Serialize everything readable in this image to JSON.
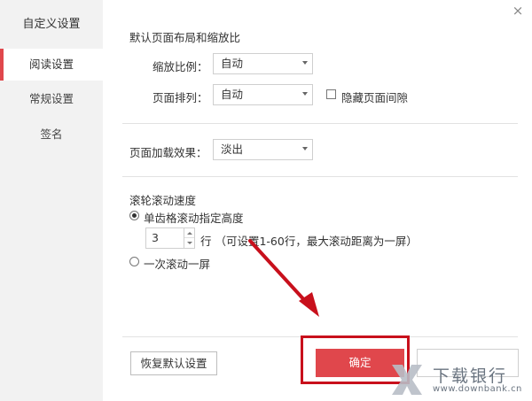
{
  "sidebar": {
    "title": "自定义设置",
    "items": [
      {
        "label": "阅读设置"
      },
      {
        "label": "常规设置"
      },
      {
        "label": "签名"
      }
    ]
  },
  "close": "×",
  "layout_section": {
    "title": "默认页面布局和缩放比",
    "zoom_label": "缩放比例：",
    "zoom_value": "自动",
    "arrange_label": "页面排列：",
    "arrange_value": "自动",
    "hide_gap_label": "隐藏页面间隙"
  },
  "load_section": {
    "label": "页面加载效果：",
    "value": "淡出"
  },
  "scroll_section": {
    "title": "滚轮滚动速度",
    "option1": "单齿格滚动指定高度",
    "lines_value": "3",
    "lines_hint": "行 （可设置1-60行，最大滚动距离为一屏）",
    "option2": "一次滚动一屏"
  },
  "buttons": {
    "restore": "恢复默认设置",
    "ok": "确定"
  },
  "watermark": {
    "text": "下载银行",
    "url": "www.downbank.cn"
  },
  "colors": {
    "accent": "#e0474c",
    "annotation": "#c8101c"
  }
}
